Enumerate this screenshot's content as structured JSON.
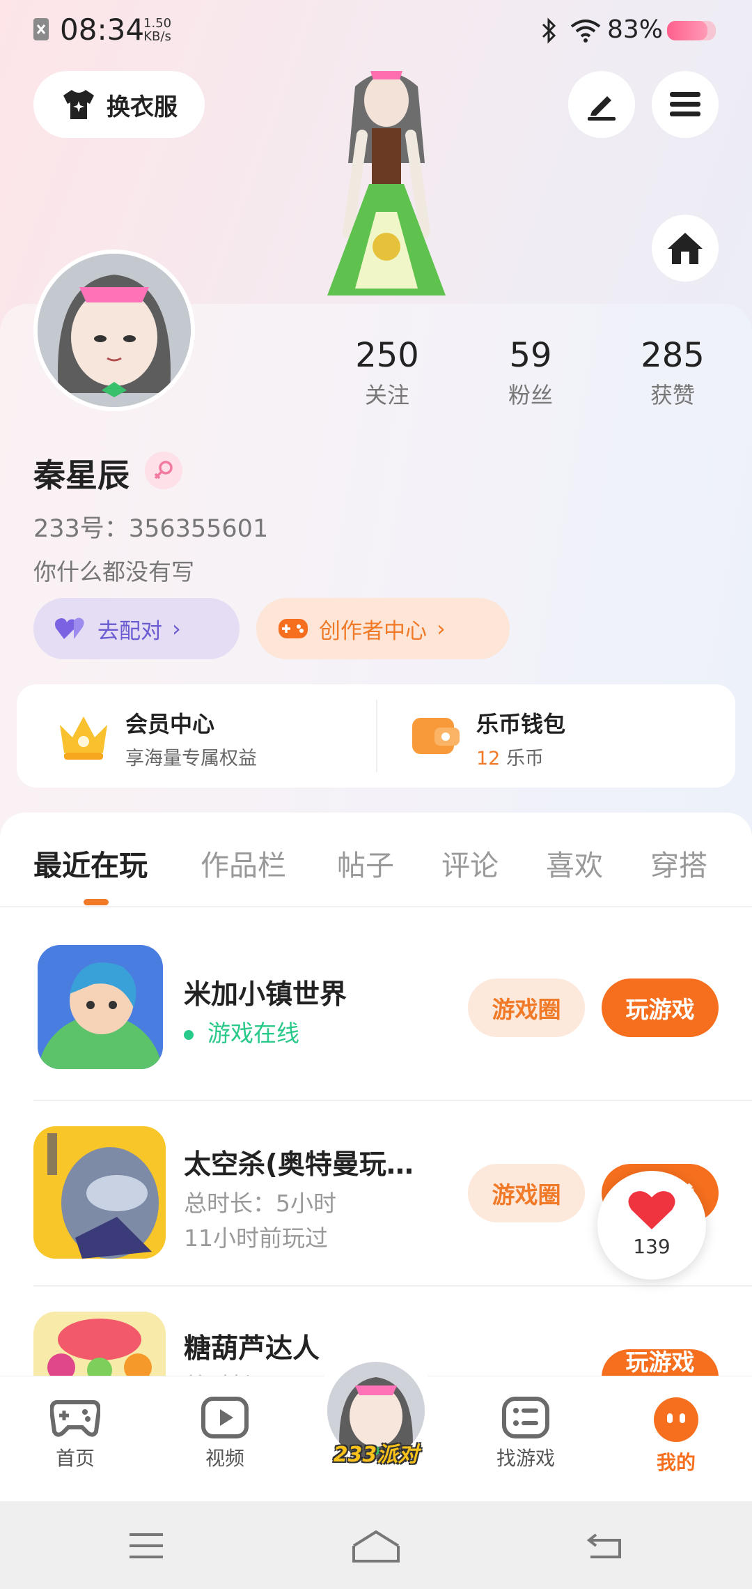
{
  "status": {
    "time": "08:34",
    "speed_value": "1.50",
    "speed_unit": "KB/s",
    "battery_text": "83%",
    "battery_level": 0.83
  },
  "header": {
    "outfit_label": "换衣服",
    "edit_icon": "pen-icon",
    "menu_icon": "menu-icon",
    "home_icon": "house-icon"
  },
  "profile": {
    "stats": [
      {
        "value": "250",
        "label": "关注"
      },
      {
        "value": "59",
        "label": "粉丝"
      },
      {
        "value": "285",
        "label": "获赞"
      }
    ],
    "name": "秦星辰",
    "id_text": "233号：356355601",
    "bio": "你什么都没有写",
    "pair_label": "去配对",
    "creator_label": "创作者中心"
  },
  "benefits": {
    "vip_title": "会员中心",
    "vip_sub": "享海量专属权益",
    "wallet_title": "乐币钱包",
    "wallet_amount": "12",
    "wallet_unit": "乐币"
  },
  "tabs": [
    "最近在玩",
    "作品栏",
    "帖子",
    "评论",
    "喜欢",
    "穿搭"
  ],
  "games": [
    {
      "title": "米加小镇世界",
      "line1": "游戏在线",
      "line2": "",
      "circle_label": "游戏圈",
      "play_label": "玩游戏"
    },
    {
      "title": "太空杀(奥特曼玩…",
      "line1": "总时长：5小时",
      "line2": "11小时前玩过",
      "circle_label": "游戏圈",
      "play_label": "玩游戏"
    },
    {
      "title": "糖葫芦达人",
      "line1": "总时长：",
      "line2": "",
      "circle_label": "",
      "play_label": "玩游戏"
    }
  ],
  "like_count": "139",
  "nav": {
    "home": "首页",
    "video": "视频",
    "center_badge": "233派对",
    "find": "找游戏",
    "mine": "我的"
  },
  "colors": {
    "accent": "#f56f1e",
    "online": "#29c98a",
    "pair": "#6a5bd1"
  }
}
